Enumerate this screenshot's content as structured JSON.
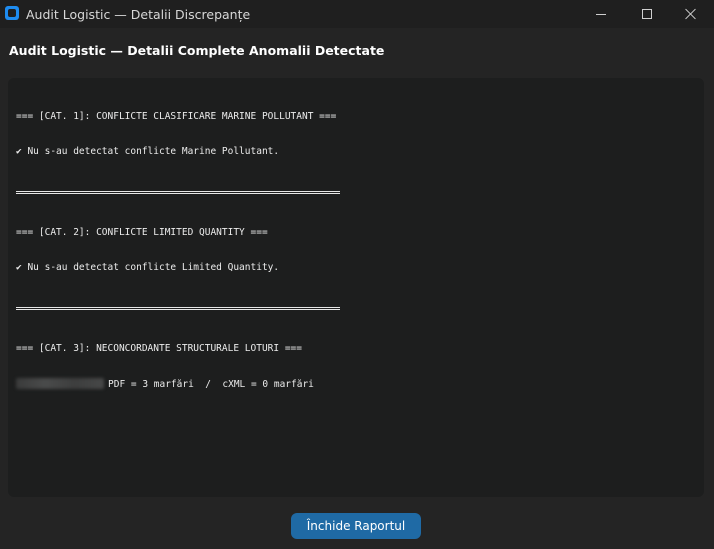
{
  "window": {
    "title": "Audit Logistic — Detalii Discrepanțe",
    "accent_color": "#1e8cf0"
  },
  "heading": "Audit Logistic — Detalii Complete Anomalii Detectate",
  "report": {
    "cat1": {
      "header": "=== [CAT. 1]: CONFLICTE CLASIFICARE MARINE POLLUTANT ===",
      "line": "✔ Nu s-au detectat conflicte Marine Pollutant."
    },
    "cat2": {
      "header": "=== [CAT. 2]: CONFLICTE LIMITED QUANTITY ===",
      "line": "✔ Nu s-au detectat conflicte Limited Quantity."
    },
    "cat3": {
      "header": "=== [CAT. 3]: NECONCORDANTE STRUCTURALE LOTURI ===",
      "line": "PDF = 3 marfări  /  cXML = 0 marfări"
    }
  },
  "footer": {
    "close_label": "Închide Raportul",
    "button_color": "#1f6aa5"
  }
}
